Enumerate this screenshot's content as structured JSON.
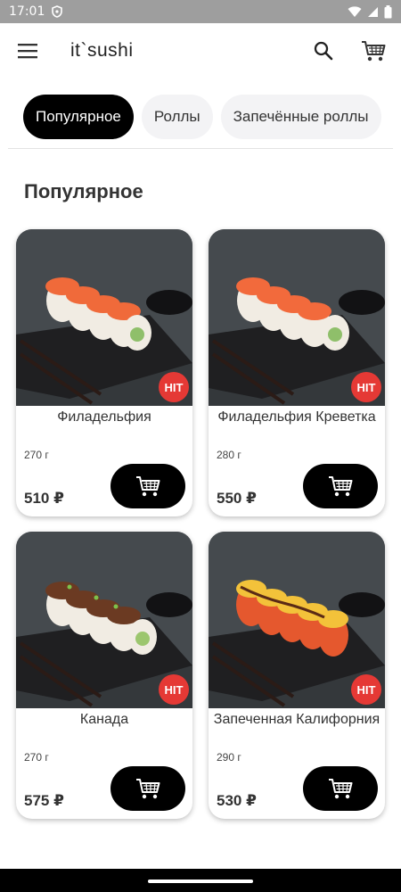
{
  "status_bar": {
    "time": "17:01"
  },
  "app_bar": {
    "title": "it`sushi",
    "icons": [
      "menu-icon",
      "search-icon",
      "cart-icon"
    ]
  },
  "tabs": [
    {
      "label": "Популярное",
      "active": true
    },
    {
      "label": "Роллы",
      "active": false
    },
    {
      "label": "Запечённые роллы",
      "active": false
    }
  ],
  "section_title": "Популярное",
  "products": [
    {
      "name": "Филадельфия",
      "weight": "270 г",
      "price": "510 ₽",
      "badge": "HIT"
    },
    {
      "name": "Филадельфия Креветка",
      "weight": "280 г",
      "price": "550 ₽",
      "badge": "HIT"
    },
    {
      "name": "Канада",
      "weight": "270 г",
      "price": "575 ₽",
      "badge": "HIT"
    },
    {
      "name": "Запеченная Калифорния",
      "weight": "290 г",
      "price": "530 ₽",
      "badge": "HIT"
    }
  ],
  "colors": {
    "accent": "#000000",
    "badge": "#e53935",
    "status_bar": "#9e9e9e"
  }
}
